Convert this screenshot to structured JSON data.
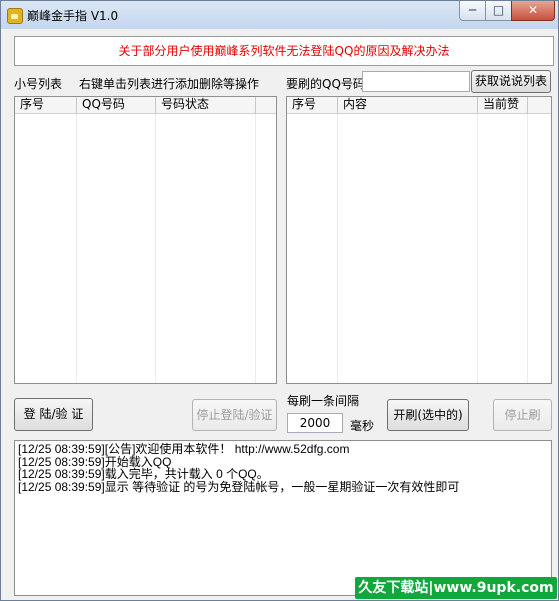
{
  "window": {
    "title": "巅峰金手指 V1.0"
  },
  "titlebar_buttons": {
    "minimize": "─",
    "maximize": "□",
    "close": "✕"
  },
  "notice": "关于部分用户使用巅峰系列软件无法登陆QQ的原因及解决办法",
  "left_panel": {
    "title": "小号列表",
    "hint": "右键单击列表进行添加删除等操作",
    "columns": [
      "序号",
      "QQ号码",
      "号码状态"
    ]
  },
  "right_panel": {
    "target_label": "要刷的QQ号码",
    "target_value": "",
    "fetch_button": "获取说说列表",
    "columns": [
      "序号",
      "内容",
      "当前赞"
    ]
  },
  "controls": {
    "login_button": "登 陆/验 证",
    "stop_login_button": "停止登陆/验证",
    "interval_label": "每刷一条间隔",
    "interval_value": "2000",
    "interval_unit": "毫秒",
    "start_button": "开刷(选中的)",
    "stop_button": "停止刷"
  },
  "log_lines": [
    "[12/25 08:39:59][公告]欢迎使用本软件！ http://www.52dfg.com",
    "[12/25 08:39:59]开始载入QQ",
    "[12/25 08:39:59]载入完毕，共计载入 0 个QQ。",
    "[12/25 08:39:59]显示 等待验证 的号为免登陆帐号，一般一星期验证一次有效性即可"
  ],
  "watermark": "久友下载站|www.9upk.com",
  "colors": {
    "notice_text": "#e60000",
    "watermark_bg": "#10a73b"
  }
}
